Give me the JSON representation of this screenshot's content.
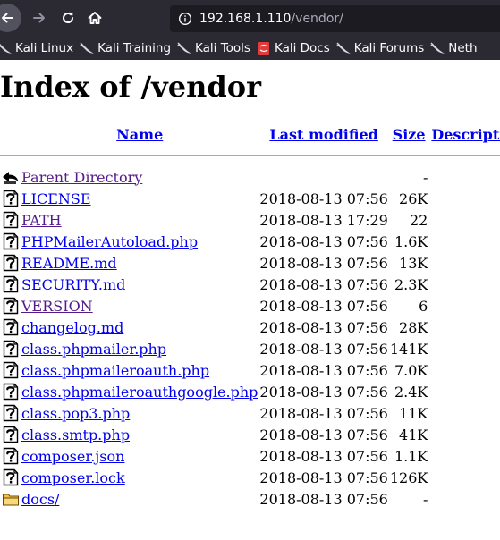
{
  "browser": {
    "url_host": "192.168.1.110",
    "url_path": "/vendor/",
    "bookmarks": [
      {
        "label": "Kali Linux",
        "icon": "kali-dragon-icon"
      },
      {
        "label": "Kali Training",
        "icon": "kali-dragon-icon"
      },
      {
        "label": "Kali Tools",
        "icon": "kali-dragon-icon"
      },
      {
        "label": "Kali Docs",
        "icon": "kali-docs-icon"
      },
      {
        "label": "Kali Forums",
        "icon": "kali-dragon-icon"
      },
      {
        "label": "Neth",
        "icon": "kali-dragon-icon"
      }
    ]
  },
  "page": {
    "title": "Index of /vendor",
    "columns": {
      "name": "Name",
      "last_modified": "Last modified",
      "size": "Size",
      "description": "Description"
    },
    "rows": [
      {
        "name": "Parent Directory",
        "modified": "",
        "size": "-",
        "icon": "parent-directory-icon",
        "visited": true
      },
      {
        "name": "LICENSE",
        "modified": "2018-08-13 07:56",
        "size": "26K",
        "icon": "unknown-file-icon",
        "visited": false
      },
      {
        "name": "PATH",
        "modified": "2018-08-13 17:29",
        "size": "22",
        "icon": "unknown-file-icon",
        "visited": true
      },
      {
        "name": "PHPMailerAutoload.php",
        "modified": "2018-08-13 07:56",
        "size": "1.6K",
        "icon": "unknown-file-icon",
        "visited": false
      },
      {
        "name": "README.md",
        "modified": "2018-08-13 07:56",
        "size": "13K",
        "icon": "unknown-file-icon",
        "visited": false
      },
      {
        "name": "SECURITY.md",
        "modified": "2018-08-13 07:56",
        "size": "2.3K",
        "icon": "unknown-file-icon",
        "visited": false
      },
      {
        "name": "VERSION",
        "modified": "2018-08-13 07:56",
        "size": "6",
        "icon": "unknown-file-icon",
        "visited": true
      },
      {
        "name": "changelog.md",
        "modified": "2018-08-13 07:56",
        "size": "28K",
        "icon": "unknown-file-icon",
        "visited": false
      },
      {
        "name": "class.phpmailer.php",
        "modified": "2018-08-13 07:56",
        "size": "141K",
        "icon": "unknown-file-icon",
        "visited": false
      },
      {
        "name": "class.phpmaileroauth.php",
        "modified": "2018-08-13 07:56",
        "size": "7.0K",
        "icon": "unknown-file-icon",
        "visited": false
      },
      {
        "name": "class.phpmaileroauthgoogle.php",
        "modified": "2018-08-13 07:56",
        "size": "2.4K",
        "icon": "unknown-file-icon",
        "visited": false
      },
      {
        "name": "class.pop3.php",
        "modified": "2018-08-13 07:56",
        "size": "11K",
        "icon": "unknown-file-icon",
        "visited": false
      },
      {
        "name": "class.smtp.php",
        "modified": "2018-08-13 07:56",
        "size": "41K",
        "icon": "unknown-file-icon",
        "visited": false
      },
      {
        "name": "composer.json",
        "modified": "2018-08-13 07:56",
        "size": "1.1K",
        "icon": "unknown-file-icon",
        "visited": false
      },
      {
        "name": "composer.lock",
        "modified": "2018-08-13 07:56",
        "size": "126K",
        "icon": "unknown-file-icon",
        "visited": false
      },
      {
        "name": "docs/",
        "modified": "2018-08-13 07:56",
        "size": "-",
        "icon": "folder-icon",
        "visited": false
      }
    ]
  }
}
